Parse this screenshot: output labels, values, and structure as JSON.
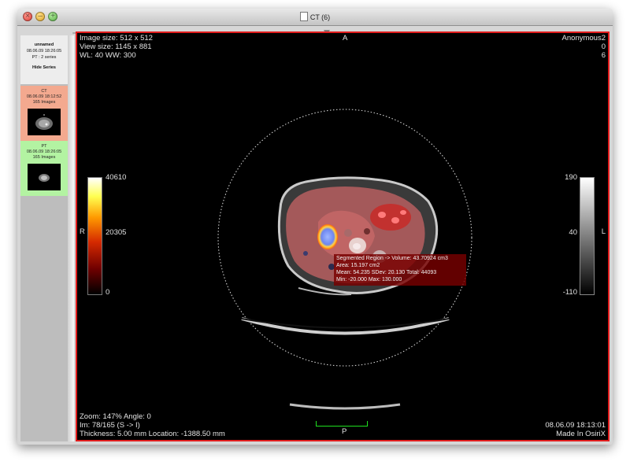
{
  "window": {
    "title": "CT (6)",
    "buttons": {
      "close_icon": "×",
      "minimize_icon": "–",
      "zoom_icon": "+"
    }
  },
  "sidebar": {
    "study": {
      "name": "unnamed",
      "date": "08.06.09 18:26:05",
      "series_count": "PT : 2 series",
      "hide_label": "Hide Series"
    },
    "series": [
      {
        "modality": "CT",
        "date": "08.06.09 18:12:52",
        "images": "165 Images",
        "color": "#f3a98f"
      },
      {
        "modality": "PT",
        "date": "08.06.09 18:26:05",
        "images": "165 Images",
        "color": "#b3f3a2"
      }
    ]
  },
  "viewer": {
    "top_left": {
      "image_size": "Image size: 512 x 512",
      "view_size": "View size: 1145 x 881",
      "wl_ww": "WL: 40 WW: 300"
    },
    "top_right": {
      "patient": "Anonymous2",
      "line2": "0",
      "line3": "6"
    },
    "orientation": {
      "top": "A",
      "left": "R",
      "right": "L",
      "bottom": "P"
    },
    "left_colorbar": {
      "max": "40610",
      "mid": "20305",
      "min": "0"
    },
    "right_colorbar": {
      "max": "190",
      "mid": "40",
      "min": "-110"
    },
    "roi": {
      "line1": "Segmented Region -> Volume: 43.70924 cm3",
      "line2": "Area: 15.197 cm2",
      "line3": "Mean: 54.235 SDev: 20.130 Total: 44093",
      "line4": "Min: -20.000 Max: 130.000"
    },
    "bottom_left": {
      "zoom": "Zoom: 147% Angle: 0",
      "image_index": "Im: 78/165  (S -> I)",
      "thickness": "Thickness: 5.00 mm Location: -1388.50 mm"
    },
    "bottom_right": {
      "datetime": "08.06.09 18:13:01",
      "credit": "Made In OsiriX"
    },
    "colors": {
      "border": "#e11d1d",
      "overlay_text": "#e3e3e3",
      "roi_box": "#780000",
      "ruler": "#1fe01f"
    }
  }
}
